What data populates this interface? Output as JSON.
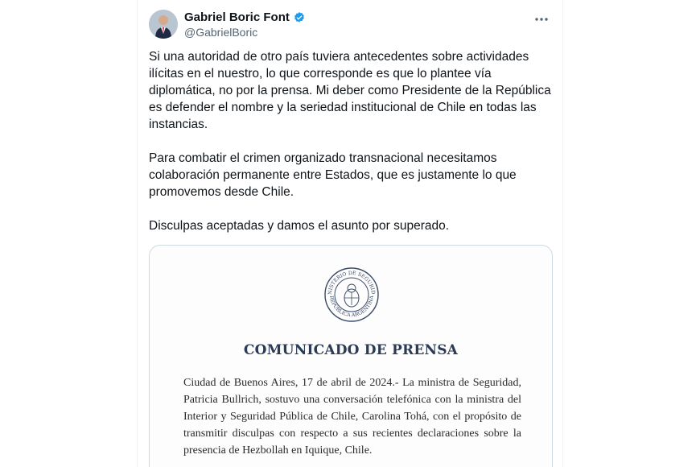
{
  "tweet": {
    "author_name": "Gabriel Boric Font",
    "author_handle": "@GabrielBoric",
    "verified": true,
    "paragraphs": [
      "Si una autoridad de otro país tuviera antecedentes sobre actividades ilícitas en el nuestro, lo que corresponde es que lo plantee vía diplomática, no por la prensa. Mi deber como Presidente de la República es defender el nombre y la seriedad institucional de Chile en todas las instancias.",
      "Para combatir el crimen organizado transnacional necesitamos colaboración permanente entre Estados, que es justamente lo que promovemos desde Chile.",
      "Disculpas aceptadas y damos el asunto por superado."
    ]
  },
  "media": {
    "seal_text_top": "MINISTERIO DE SEGURIDAD",
    "seal_text_bottom": "REPÚBLICA ARGENTINA",
    "doc_title": "COMUNICADO DE PRENSA",
    "doc_body": "Ciudad de Buenos Aires, 17 de abril de 2024.- La ministra de Seguridad, Patricia Bullrich, sostuvo una conversación telefónica con la ministra del Interior y Seguridad Pública de Chile, Carolina Tohá, con el propósito de transmitir disculpas con respecto a sus recientes declaraciones sobre la presencia de Hezbollah en Iquique, Chile."
  },
  "colors": {
    "verified": "#1d9bf0",
    "text_primary": "#0f1419",
    "text_secondary": "#536471",
    "doc_title": "#2b3a55"
  },
  "icons": {
    "verified": "verified-badge-icon",
    "more": "more-options-icon"
  }
}
